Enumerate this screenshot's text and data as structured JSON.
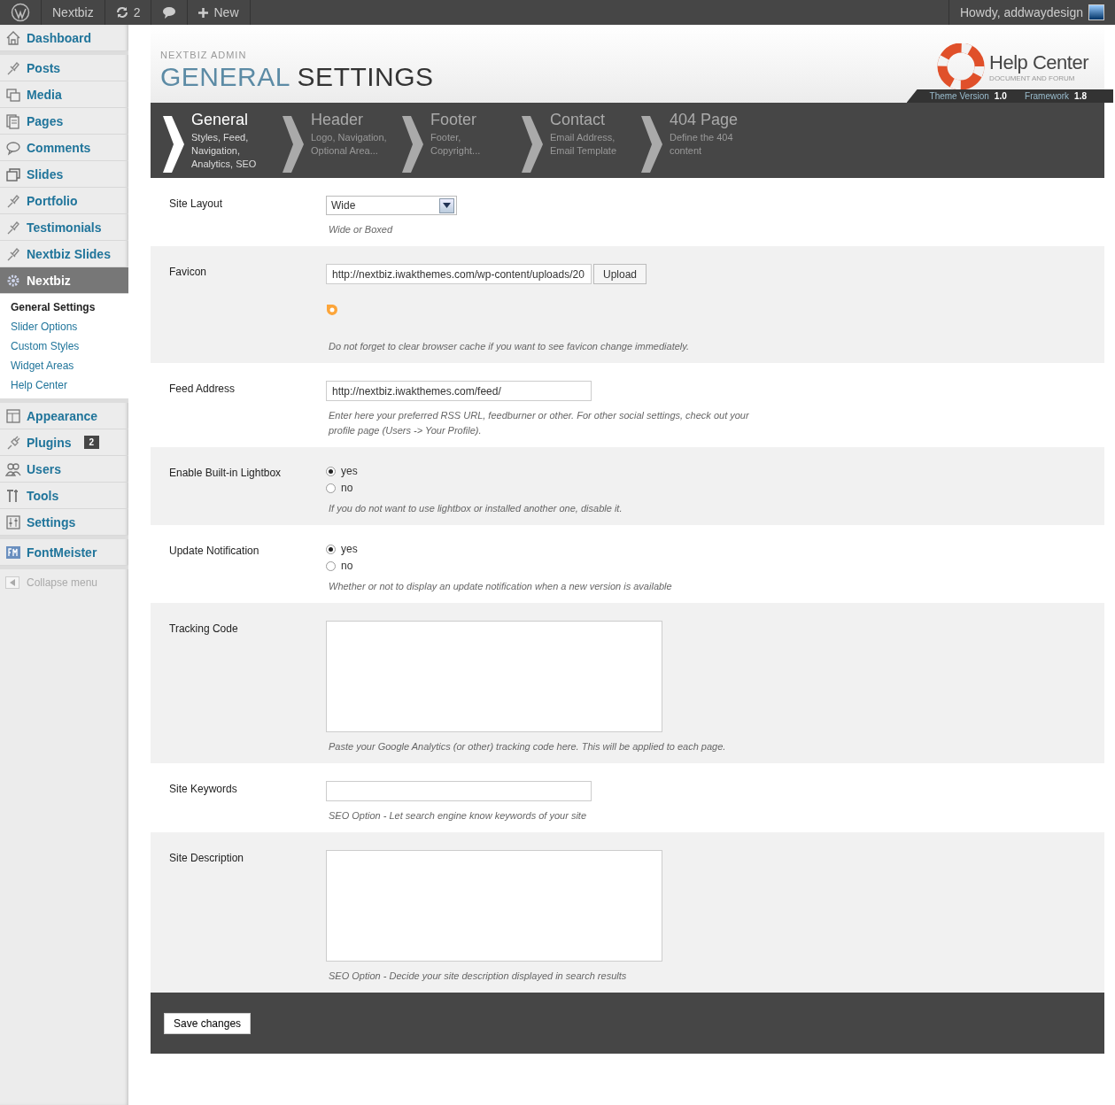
{
  "admin_bar": {
    "site": "Nextbiz",
    "updates": "2",
    "new_label": "New",
    "greeting": "Howdy, addwaydesign"
  },
  "sidebar": {
    "groups": [
      [
        {
          "label": "Dashboard",
          "selected": false
        }
      ],
      [
        {
          "label": "Posts",
          "selected": false
        },
        {
          "label": "Media",
          "selected": false
        },
        {
          "label": "Pages",
          "selected": false
        },
        {
          "label": "Comments",
          "selected": false
        },
        {
          "label": "Slides",
          "selected": false
        },
        {
          "label": "Portfolio",
          "selected": false
        },
        {
          "label": "Testimonials",
          "selected": false
        },
        {
          "label": "Nextbiz Slides",
          "selected": false
        },
        {
          "label": "Nextbiz",
          "selected": true,
          "children": [
            {
              "label": "General Settings",
              "selected": true
            },
            {
              "label": "Slider Options",
              "selected": false
            },
            {
              "label": "Custom Styles",
              "selected": false
            },
            {
              "label": "Widget Areas",
              "selected": false
            },
            {
              "label": "Help Center",
              "selected": false
            }
          ]
        }
      ],
      [
        {
          "label": "Appearance",
          "selected": false
        },
        {
          "label": "Plugins",
          "selected": false,
          "badge": "2"
        },
        {
          "label": "Users",
          "selected": false
        },
        {
          "label": "Tools",
          "selected": false
        },
        {
          "label": "Settings",
          "selected": false
        }
      ],
      [
        {
          "label": "FontMeister",
          "selected": false
        }
      ]
    ],
    "collapse": "Collapse menu"
  },
  "header": {
    "kicker": "NEXTBIZ ADMIN",
    "title_highlight": "GENERAL",
    "title_rest": "SETTINGS",
    "help": {
      "title": "Help Center",
      "subtitle": "DOCUMENT AND FORUM",
      "theme_version_label": "Theme Version",
      "theme_version": "1.0",
      "framework_label": "Framework",
      "framework": "1.8"
    }
  },
  "tabs": [
    {
      "title": "General",
      "subtitle": "Styles, Feed, Navigation, Analytics, SEO",
      "selected": true
    },
    {
      "title": "Header",
      "subtitle": "Logo, Navigation, Optional Area...",
      "selected": false
    },
    {
      "title": "Footer",
      "subtitle": "Footer, Copyright...",
      "selected": false
    },
    {
      "title": "Contact",
      "subtitle": "Email Address, Email Template",
      "selected": false
    },
    {
      "title": "404 Page",
      "subtitle": "Define the 404 content",
      "selected": false
    }
  ],
  "settings": [
    {
      "kind": "select",
      "label": "Site Layout",
      "value": "Wide",
      "hint": "Wide or Boxed"
    },
    {
      "kind": "upload",
      "label": "Favicon",
      "value": "http://nextbiz.iwakthemes.com/wp-content/uploads/20",
      "button": "Upload",
      "hint": "Do not forget to clear browser cache if you want to see favicon change immediately."
    },
    {
      "kind": "text",
      "label": "Feed Address",
      "value": "http://nextbiz.iwakthemes.com/feed/",
      "hint": "Enter here your preferred RSS URL, feedburner or other. For other social settings, check out your profile page (Users -> Your Profile)."
    },
    {
      "kind": "radio",
      "label": "Enable Built-in Lightbox",
      "options": [
        {
          "label": "yes",
          "selected": true
        },
        {
          "label": "no",
          "selected": false
        }
      ],
      "hint": "If you do not want to use lightbox or installed another one, disable it."
    },
    {
      "kind": "radio",
      "label": "Update Notification",
      "options": [
        {
          "label": "yes",
          "selected": true
        },
        {
          "label": "no",
          "selected": false
        }
      ],
      "hint": "Whether or not to display an update notification when a new version is available"
    },
    {
      "kind": "textarea",
      "label": "Tracking Code",
      "hint": "Paste your Google Analytics (or other) tracking code here. This will be applied to each page."
    },
    {
      "kind": "text",
      "label": "Site Keywords",
      "hint": "SEO Option - Let search engine know keywords of your site"
    },
    {
      "kind": "textarea",
      "label": "Site Description",
      "hint": "SEO Option - Decide your site description displayed in search results"
    }
  ],
  "save_button": "Save changes"
}
